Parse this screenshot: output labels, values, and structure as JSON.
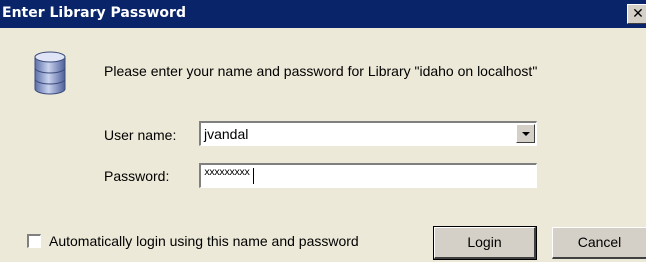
{
  "window": {
    "title": "Enter Library Password",
    "close_glyph": "✕",
    "close_icon": "close-icon"
  },
  "prompt": "Please enter your name and password for Library \"idaho on localhost\"",
  "icon": "database-icon",
  "user": {
    "label": "User name:",
    "value": "jvandal"
  },
  "password": {
    "label": "Password:",
    "masked_value": "xxxxxxxxx"
  },
  "auto_login": {
    "label": "Automatically login using this name and password",
    "checked": false
  },
  "buttons": {
    "login": "Login",
    "cancel": "Cancel"
  },
  "colors": {
    "titlebar": "#0a246a",
    "dialog_bg": "#ece9d8"
  }
}
